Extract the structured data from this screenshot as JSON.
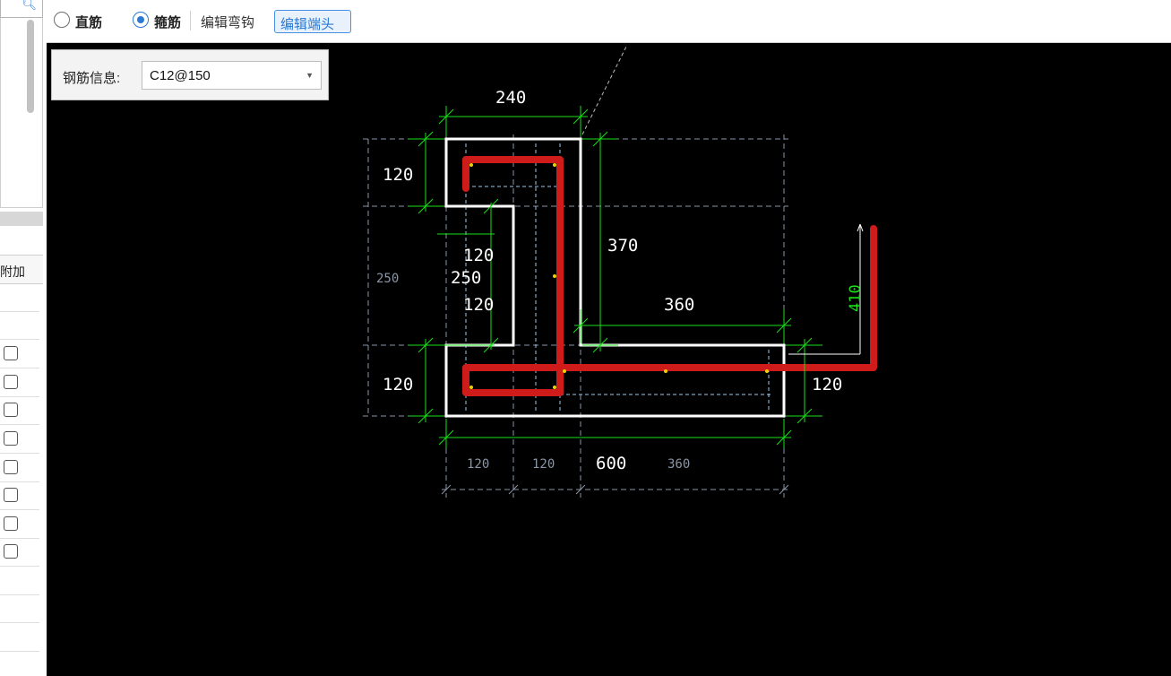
{
  "toolbar": {
    "straight_label": "直筋",
    "stirrup_label": "箍筋",
    "edit_hook_label": "编辑弯钩",
    "edit_end_label": "编辑端头",
    "selected": "stirrup"
  },
  "left_panel": {
    "header_fragment": "附加",
    "checkbox_count": 8
  },
  "rebar_info": {
    "label": "钢筋信息:",
    "value": "C12@150"
  },
  "drawing": {
    "dim_top": "240",
    "dim_left_top": "120",
    "dim_mid_120a": "120",
    "dim_mid_250": "250",
    "dim_mid_120b": "120",
    "dim_left_outer_250": "250",
    "dim_left_bottom": "120",
    "dim_right_370": "370",
    "dim_right_360": "360",
    "dim_right_120": "120",
    "dim_leg_410": "410",
    "dim_bottom_600": "600",
    "dim_bottom_120a": "120",
    "dim_bottom_120b": "120",
    "dim_bottom_360": "360"
  },
  "colors": {
    "canvas_bg": "#000000",
    "section_outline": "#ffffff",
    "rebar": "#d01b1b",
    "dimension": "#19e019",
    "grid": "#8a96a8",
    "accent": "#2b79d3"
  }
}
